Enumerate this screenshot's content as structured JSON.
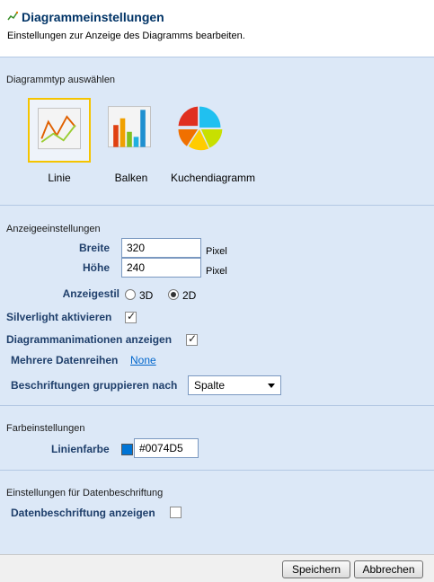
{
  "header": {
    "title": "Diagrammeinstellungen",
    "subtitle": "Einstellungen zur Anzeige des Diagramms bearbeiten."
  },
  "chart_type_section": {
    "title": "Diagrammtyp auswählen",
    "options": [
      {
        "label": "Linie",
        "icon": "line-chart-icon",
        "selected": true
      },
      {
        "label": "Balken",
        "icon": "bar-chart-icon",
        "selected": false
      },
      {
        "label": "Kuchendiagramm",
        "icon": "pie-chart-icon",
        "selected": false
      }
    ]
  },
  "display_section": {
    "title": "Anzeigeeinstellungen",
    "width_label": "Breite",
    "width_value": "320",
    "height_label": "Höhe",
    "height_value": "240",
    "unit": "Pixel",
    "style_label": "Anzeigestil",
    "style_3d": "3D",
    "style_2d": "2D",
    "style_selected": "2D",
    "silverlight_label": "Silverlight aktivieren",
    "silverlight_checked": true,
    "animations_label": "Diagrammanimationen anzeigen",
    "animations_checked": true,
    "series_label": "Mehrere Datenreihen",
    "series_link": "None",
    "group_label": "Beschriftungen gruppieren nach",
    "group_value": "Spalte"
  },
  "color_section": {
    "title": "Farbeinstellungen",
    "line_color_label": "Linienfarbe",
    "line_color_value": "#0074D5",
    "swatch_color": "#0074D5"
  },
  "data_label_section": {
    "title": "Einstellungen für Datenbeschriftung",
    "show_label": "Datenbeschriftung anzeigen",
    "show_checked": false
  },
  "footer": {
    "save_label": "Speichern",
    "cancel_label": "Abbrechen"
  },
  "colors": {
    "panel_bg": "#dce8f7",
    "label_blue": "#1f3f6b",
    "selection_border": "#f5c400",
    "link": "#0066cc"
  }
}
